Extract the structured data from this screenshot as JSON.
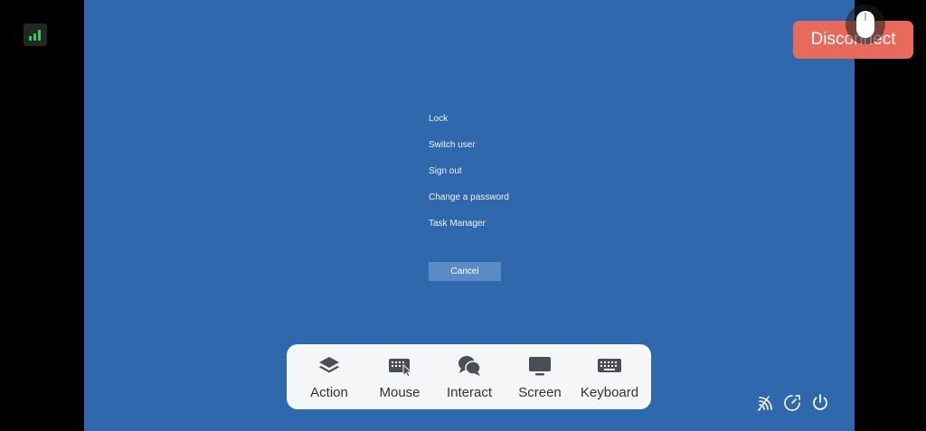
{
  "colors": {
    "desktop_background": "#3068ad",
    "cancel_button_background": "#5a8bc4",
    "disconnect_background": "#e86a5d",
    "signal_bars": "#3cc05a",
    "toolbar_background": "#f5f6f8",
    "toolbar_icon": "#4a4f57"
  },
  "security_menu": {
    "items": [
      "Lock",
      "Switch user",
      "Sign out",
      "Change a password",
      "Task Manager"
    ],
    "cancel_label": "Cancel"
  },
  "header": {
    "disconnect_label": "Disconnect",
    "signal_icon": "signal-strength-icon",
    "mouse_icon": "mouse-icon"
  },
  "toolbar": {
    "items": [
      {
        "label": "Action",
        "icon": "layers-icon"
      },
      {
        "label": "Mouse",
        "icon": "keyboard-mouse-icon"
      },
      {
        "label": "Interact",
        "icon": "chat-bubbles-icon"
      },
      {
        "label": "Screen",
        "icon": "monitor-icon"
      },
      {
        "label": "Keyboard",
        "icon": "keyboard-icon"
      }
    ]
  },
  "system_icons": [
    "network-icon",
    "speed-icon",
    "power-icon"
  ]
}
